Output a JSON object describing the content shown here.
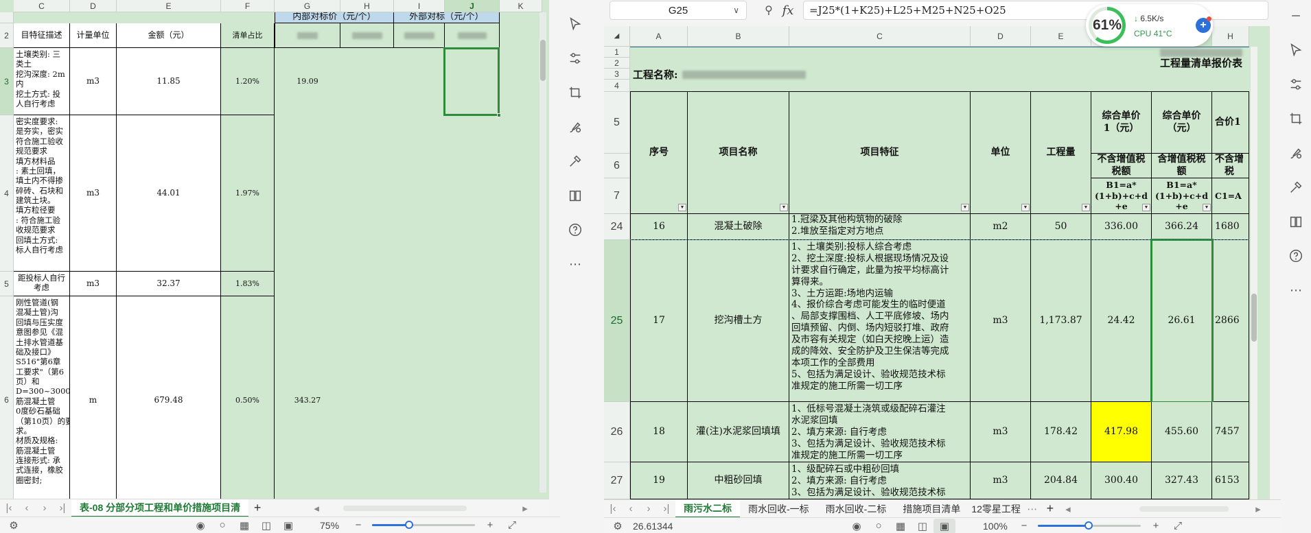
{
  "left_sheet": {
    "columns": [
      "C",
      "D",
      "E",
      "F",
      "G",
      "H",
      "I",
      "J",
      "K"
    ],
    "selected_column": "J",
    "group_headers": {
      "internal": "内部对标价（元/个）",
      "external": "外部对标（元/个）"
    },
    "header_row": {
      "c": "目特征描述",
      "d": "计量单位",
      "e": "金额（元）",
      "f": "清单占比"
    },
    "rows": [
      {
        "num": "2"
      },
      {
        "num": "3",
        "c": "土壤类别: 三\n类土\n挖沟深度: 2m\n内\n挖土方式: 投\n人自行考虑",
        "d": "m3",
        "e": "11.85",
        "f": "1.20%",
        "g": "19.09"
      },
      {
        "num": "4",
        "c": "密实度要求:\n是夯实，密实\n符合施工验收\n规范要求\n填方材料品\n: 素土回填，\n填土内不得掺\n碎砖、石块和\n建筑土块。\n填方粒径要\n: 符合施工验\n收规范要求\n回填土方式:\n标人自行考虑",
        "d": "m3",
        "e": "44.01",
        "f": "1.97%"
      },
      {
        "num": "5",
        "c": "距投标人自行\n考虑",
        "d": "m3",
        "e": "32.37",
        "f": "1.83%"
      },
      {
        "num": "6",
        "c": "刚性管道(钢\n混凝土管)沟\n回填与压实度\n意图参见《混\n土排水管道基\n础及接口》\nS516\"第6章\n工要求\"（第6\n页）和\nD=300~3000\n筋混凝土管\n0度砂石基础\n（第10页）的要\n求。\n材质及规格:\n筋混凝土管\n连接形式: 承\n式连接，橡胶\n圈密封;",
        "d": "m",
        "e": "679.48",
        "f": "0.50%",
        "g": "343.27"
      }
    ],
    "tabs": [
      "表-08 分部分项工程和单价措施项目清"
    ],
    "zoom": "75%"
  },
  "right_window": {
    "namebox": "G25",
    "fx": "fx",
    "formula": "=J25*(1+K25)+L25+M25+N25+O25",
    "columns": [
      "A",
      "B",
      "C",
      "D",
      "E",
      "F",
      "G",
      "H"
    ],
    "selected_column": "G",
    "sheet_title": "工程量清单报价表",
    "project_name_label": "工程名称:",
    "header": {
      "seq": "序号",
      "name": "项目名称",
      "feature": "项目特征",
      "unit": "单位",
      "qty": "工程量",
      "f_top": "综合单价\n1（元）",
      "g_top": "综合单价\n（元）",
      "h_top": "合价1",
      "f_mid": "不含增值税\n税额",
      "g_mid": "含增值税税\n额",
      "h_mid": "不含增\n税",
      "f_bot": "B1=a*\n(1+b)+c+d\n+e",
      "g_bot": "B1=a*\n(1+b)+c+d\n+e",
      "h_bot": "C1=A"
    },
    "rows": [
      {
        "num": "24",
        "seq": "16",
        "name": "混凝土破除",
        "feature": "1.冠梁及其他构筑物的破除\n2.堆放至指定对方地点",
        "unit": "m2",
        "qty": "50",
        "f": "336.00",
        "g": "366.24",
        "h": "1680"
      },
      {
        "num": "25",
        "seq": "17",
        "name": "挖沟槽土方",
        "feature": "1、土壤类别:投标人综合考虑\n2、挖土深度:投标人根据现场情况及设\n计要求自行确定，此量为按平均标高计\n算得来。\n3、土方运距:场地内运输\n4、报价综合考虑可能发生的临时便道\n、局部支撑围档、人工平底修坡、场内\n回填预留、内倒、场内短驳打堆、政府\n及市容有关规定（如白天挖晚上运）造\n成的降效、安全防护及卫生保洁等完成\n本项工作的全部费用\n5、包括为满足设计、验收规范技术标\n准规定的施工所需一切工序",
        "unit": "m3",
        "qty": "1,173.87",
        "f": "24.42",
        "g": "26.61",
        "h": "2866"
      },
      {
        "num": "26",
        "seq": "18",
        "name": "灌(注)水泥浆回填填",
        "feature": "1、低标号混凝土浇筑或级配碎石灌注\n水泥浆回填\n2、填方来源: 自行考虑\n3、包括为满足设计、验收规范技术标\n准规定的施工所需一切工序",
        "unit": "m3",
        "qty": "178.42",
        "f": "417.98",
        "g": "455.60",
        "h": "7457"
      },
      {
        "num": "27",
        "seq": "19",
        "name": "中粗砂回填",
        "feature": "1、级配碎石或中粗砂回填\n2、填方来源: 自行考虑\n3、包括为满足设计、验收规范技术标",
        "unit": "m3",
        "qty": "204.84",
        "f": "300.40",
        "g": "327.43",
        "h": "6153"
      }
    ],
    "row_header_nums": [
      "1",
      "2",
      "3",
      "4",
      "5",
      "6",
      "7"
    ],
    "tabs": [
      "雨污水二标",
      "雨水回收-一标",
      "雨水回收-二标",
      "措施项目清单",
      "12零星工程"
    ],
    "status_value": "26.61344",
    "zoom": "100%"
  },
  "perf_widget": {
    "percent": "61%",
    "net": "6.5K/s",
    "cpu_label": "CPU",
    "cpu_temp": "41°C"
  },
  "colors": {
    "sheet_bg": "#cfe8cf",
    "highlight": "#ffff00",
    "accent": "#1e7a34",
    "selection": "#2e8b3a"
  }
}
